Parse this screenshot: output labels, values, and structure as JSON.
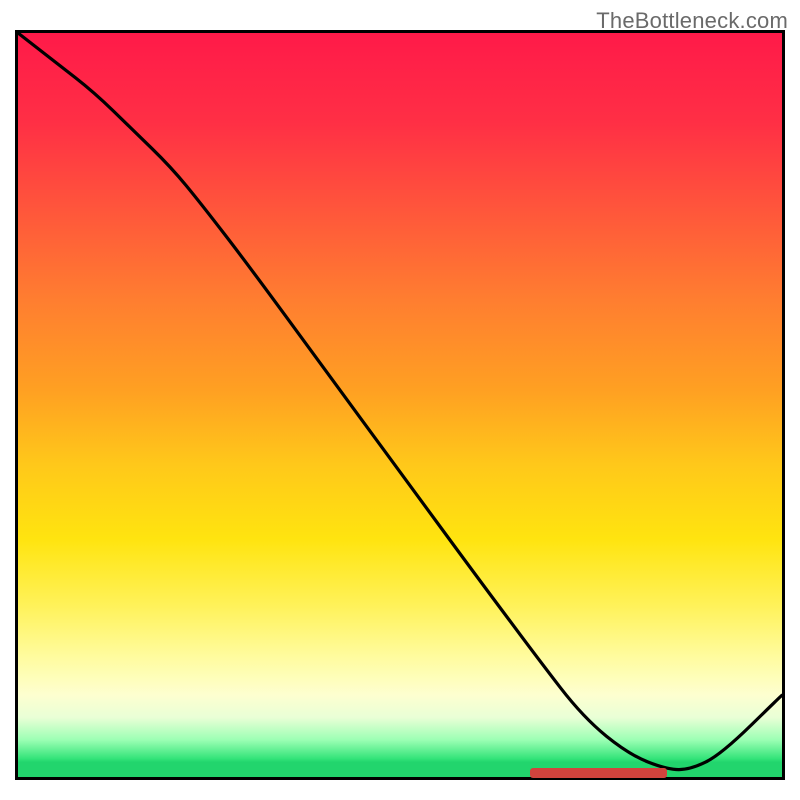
{
  "attribution": "TheBottleneck.com",
  "chart_data": {
    "type": "line",
    "title": "",
    "xlabel": "",
    "ylabel": "",
    "xlim": [
      0,
      1
    ],
    "ylim": [
      0,
      1
    ],
    "series": [
      {
        "name": "curve",
        "x": [
          0.0,
          0.05,
          0.1,
          0.15,
          0.2,
          0.24,
          0.3,
          0.4,
          0.5,
          0.6,
          0.68,
          0.74,
          0.8,
          0.85,
          0.88,
          0.92,
          1.0
        ],
        "y": [
          1.0,
          0.96,
          0.92,
          0.87,
          0.82,
          0.77,
          0.69,
          0.55,
          0.41,
          0.27,
          0.16,
          0.08,
          0.03,
          0.01,
          0.01,
          0.03,
          0.11
        ]
      }
    ],
    "marker": {
      "x_start": 0.67,
      "x_end": 0.85,
      "y": 0.006
    },
    "background_gradient": {
      "orientation": "vertical",
      "stops": [
        {
          "pos": 0.0,
          "color": "#ff1a49"
        },
        {
          "pos": 0.25,
          "color": "#ff5a3a"
        },
        {
          "pos": 0.5,
          "color": "#ffa022"
        },
        {
          "pos": 0.7,
          "color": "#ffe40f"
        },
        {
          "pos": 0.88,
          "color": "#fdffd0"
        },
        {
          "pos": 0.97,
          "color": "#35e47a"
        },
        {
          "pos": 1.0,
          "color": "#22d56d"
        }
      ]
    }
  }
}
